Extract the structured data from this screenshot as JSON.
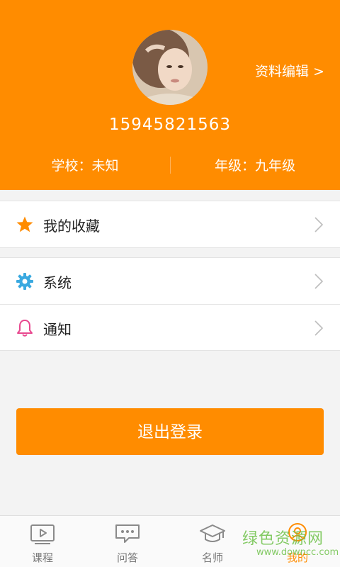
{
  "header": {
    "edit_label": "资料编辑 >",
    "phone": "15945821563",
    "school": "学校：未知",
    "grade": "年级：九年级"
  },
  "menu": {
    "favorites": {
      "label": "我的收藏",
      "icon": "star-icon"
    },
    "system": {
      "label": "系统",
      "icon": "gear-icon"
    },
    "notify": {
      "label": "通知",
      "icon": "bell-icon"
    }
  },
  "logout_label": "退出登录",
  "tabs": [
    {
      "label": "课程",
      "icon": "play-video-icon"
    },
    {
      "label": "问答",
      "icon": "chat-bubble-icon"
    },
    {
      "label": "名师",
      "icon": "graduation-cap-icon"
    },
    {
      "label": "我的",
      "icon": "user-icon",
      "active": true
    }
  ],
  "watermark": {
    "cn": "绿色资源网",
    "en": "www.downcc.com"
  },
  "colors": {
    "accent": "#ff8c00",
    "star": "#ff8c00",
    "gear": "#3aa9e0",
    "bell": "#e8488f",
    "watermark": "#6fc24b"
  }
}
